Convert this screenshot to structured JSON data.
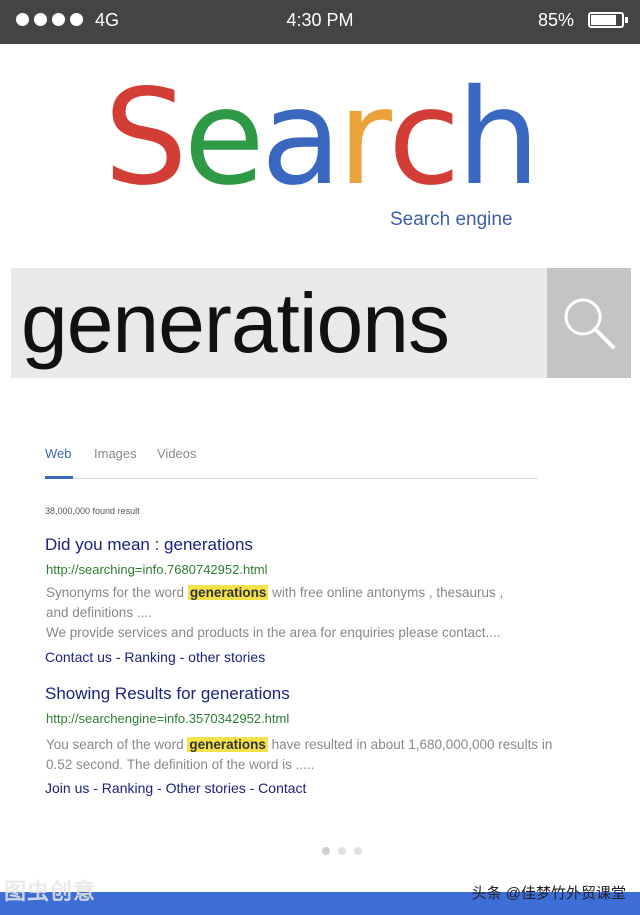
{
  "status_bar": {
    "network": "4G",
    "time": "4:30 PM",
    "battery_percent": "85%",
    "battery_level": 0.85
  },
  "logo": {
    "letters": [
      {
        "char": "S",
        "color": "#d23d36"
      },
      {
        "char": "e",
        "color": "#2e9a46"
      },
      {
        "char": "a",
        "color": "#3a67c0"
      },
      {
        "char": "r",
        "color": "#eba23a"
      },
      {
        "char": "c",
        "color": "#d23d36"
      },
      {
        "char": "h",
        "color": "#3a67c0"
      }
    ],
    "tagline": "Search engine"
  },
  "search": {
    "query": "generations",
    "button_icon": "search-icon"
  },
  "tabs": [
    "Web",
    "Images",
    "Videos"
  ],
  "results_count": "38,000,000 found result",
  "results": [
    {
      "title": "Did you mean : generations",
      "url": "http://searching=info.7680742952.html",
      "snippet_1a": "Synonyms for the word ",
      "highlight": "generations",
      "snippet_1b": " with free online antonyms , thesaurus ,",
      "snippet_2": "and definitions ....",
      "snippet_3": "We provide services and products in the area for enquiries please contact....",
      "links": "Contact us - Ranking - other stories"
    },
    {
      "title": "Showing Results for generations",
      "url": "http://searchengine=info.3570342952.html",
      "snippet_1a": "You search of the word ",
      "highlight": "generations",
      "snippet_1b": " have resulted in about 1,680,000,000 results in",
      "snippet_2": "0.52 second. The definition of the word is .....",
      "links": "Join us - Ranking - Other stories - Contact"
    }
  ],
  "watermark_left": "图虫创意",
  "watermark_right": "头条 @佳梦竹外贸课堂"
}
